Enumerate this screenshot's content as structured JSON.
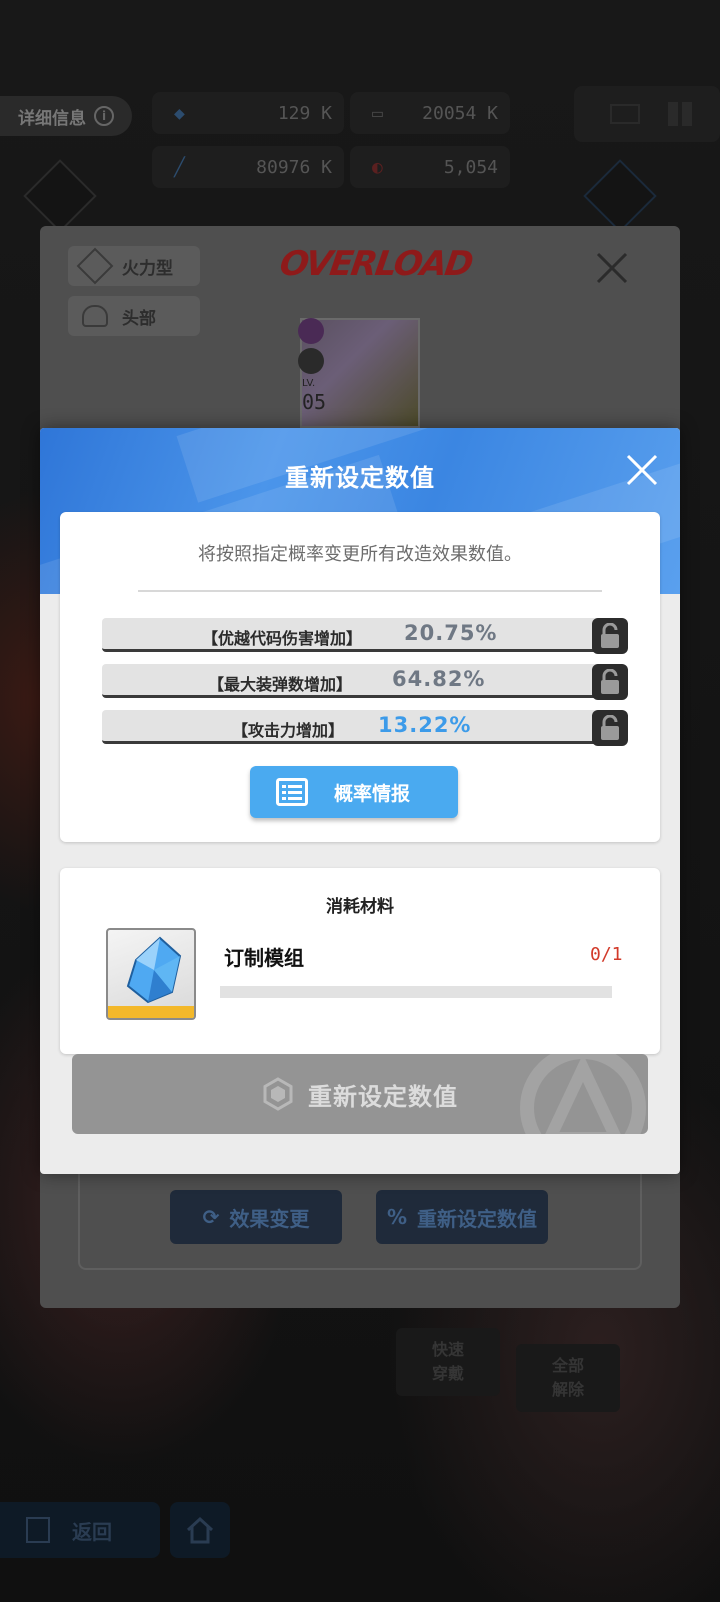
{
  "background": {
    "detail_tab": "详细信息",
    "stats": {
      "hp": "129 K",
      "ammo": "20054 K",
      "attack": "80976 K",
      "defense": "5,054"
    },
    "equip_panel": {
      "class_chip": "火力型",
      "slot_chip": "头部",
      "brand": "OVERLOAD",
      "level_label": "LV.",
      "level": "05",
      "effect_change_button": "效果变更",
      "reset_values_button": "重新设定数值"
    },
    "quick_equip_button": "快速\n穿戴",
    "remove_all_button": "全部\n解除",
    "return_button": "返回"
  },
  "modal": {
    "title": "重新设定数值",
    "description": "将按照指定概率变更所有改造效果数值。",
    "effects": [
      {
        "name": "【优越代码伤害增加】",
        "value": "20.75%",
        "color": "#6f7884"
      },
      {
        "name": "【最大装弹数增加】",
        "value": "64.82%",
        "color": "#6f7884"
      },
      {
        "name": "【攻击力增加】",
        "value": "13.22%",
        "color": "#3d9be9"
      }
    ],
    "probability_button": "概率情报",
    "materials": {
      "title": "消耗材料",
      "item_name": "订制模组",
      "count": "0/1",
      "progress": 0
    },
    "confirm_button": "重新设定数值"
  },
  "colors": {
    "header_blue": "#3b86e2",
    "button_blue": "#4aaaf0",
    "count_red": "#d23a2a",
    "disabled_gray": "#949494"
  }
}
